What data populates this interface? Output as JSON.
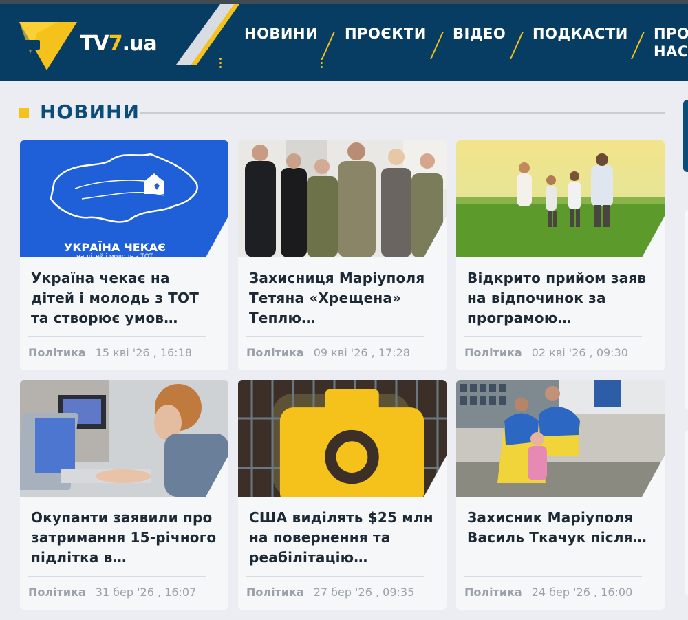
{
  "header": {
    "logo_text_tv": "TV",
    "logo_text_7": "7",
    "logo_text_ua": ".ua",
    "nav": [
      "НОВИНИ",
      "ПРОЄКТИ",
      "ВІДЕО",
      "ПОДКАСТИ",
      "ПРО",
      "НАС"
    ]
  },
  "section": {
    "title": "НОВИНИ"
  },
  "colors": {
    "brand_blue": "#083d63",
    "accent_yellow": "#f5c21b",
    "title_blue": "#0b4d7a"
  },
  "news": [
    {
      "title": "Україна чекає на дітей і молодь з ТОТ та створює умов…",
      "category": "Політика",
      "date": "15 кві '26 , 16:18",
      "image_caption": "УКРАЇНА ЧЕКАЄ",
      "image_subcaption": "на дітей і молодь з ТОТ"
    },
    {
      "title": "Захисниця Маріуполя Тетяна «Хрещена» Теплю…",
      "category": "Політика",
      "date": "09 кві '26 , 17:28"
    },
    {
      "title": "Відкрито прийом заяв на відпочинок за програмою…",
      "category": "Політика",
      "date": "02 кві '26 , 09:30"
    },
    {
      "title": "Окупанти заявили про затримання 15-річного підлітка в…",
      "category": "Політика",
      "date": "31 бер '26 , 16:07"
    },
    {
      "title": "США виділять $25 млн на повернення та реабілітацію…",
      "category": "Політика",
      "date": "27 бер '26 , 09:35",
      "icon": "camera-icon"
    },
    {
      "title": "Захисник Маріуполя Василь Ткачук після…",
      "category": "Політика",
      "date": "24 бер '26 , 16:00"
    }
  ]
}
